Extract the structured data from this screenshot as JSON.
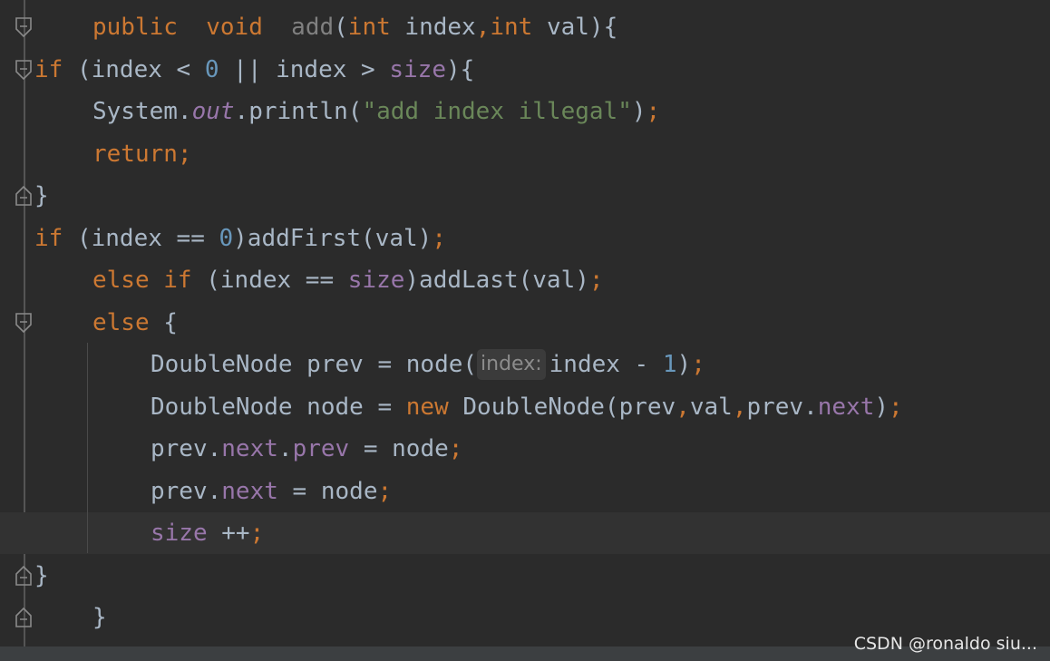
{
  "editor": {
    "colors": {
      "background": "#2b2b2b",
      "current_line": "#323232",
      "keyword": "#cc7832",
      "identifier": "#a9b7c6",
      "field": "#9876aa",
      "number": "#6897bb",
      "string": "#6a8759",
      "unused": "#808080"
    },
    "lines": [
      {
        "tokens": [
          {
            "t": "public",
            "c": "#cc7832"
          },
          {
            "t": "  ",
            "c": "#a9b7c6"
          },
          {
            "t": "void",
            "c": "#cc7832"
          },
          {
            "t": "  ",
            "c": "#a9b7c6"
          },
          {
            "t": "add",
            "c": "#808080"
          },
          {
            "t": "(",
            "c": "#a9b7c6"
          },
          {
            "t": "int",
            "c": "#cc7832"
          },
          {
            "t": " index",
            "c": "#a9b7c6"
          },
          {
            "t": ",",
            "c": "#cc7832"
          },
          {
            "t": "int",
            "c": "#cc7832"
          },
          {
            "t": " val){",
            "c": "#a9b7c6"
          }
        ]
      },
      {
        "tokens": [
          {
            "t": "if",
            "c": "#cc7832"
          },
          {
            "t": " (index < ",
            "c": "#a9b7c6"
          },
          {
            "t": "0",
            "c": "#6897bb"
          },
          {
            "t": " || index > ",
            "c": "#a9b7c6"
          },
          {
            "t": "size",
            "c": "#9876aa"
          },
          {
            "t": "){",
            "c": "#a9b7c6"
          }
        ]
      },
      {
        "tokens": [
          {
            "t": "System.",
            "c": "#a9b7c6"
          },
          {
            "t": "out",
            "c": "#9876aa",
            "i": true
          },
          {
            "t": ".println(",
            "c": "#a9b7c6"
          },
          {
            "t": "\"add index illegal\"",
            "c": "#6a8759"
          },
          {
            "t": ")",
            "c": "#a9b7c6"
          },
          {
            "t": ";",
            "c": "#cc7832"
          }
        ]
      },
      {
        "tokens": [
          {
            "t": "return;",
            "c": "#cc7832"
          }
        ]
      },
      {
        "tokens": [
          {
            "t": "}",
            "c": "#a9b7c6"
          }
        ]
      },
      {
        "tokens": [
          {
            "t": "if",
            "c": "#cc7832"
          },
          {
            "t": " (index == ",
            "c": "#a9b7c6"
          },
          {
            "t": "0",
            "c": "#6897bb"
          },
          {
            "t": ")addFirst(val)",
            "c": "#a9b7c6"
          },
          {
            "t": ";",
            "c": "#cc7832"
          }
        ]
      },
      {
        "tokens": [
          {
            "t": "else if",
            "c": "#cc7832"
          },
          {
            "t": " (index == ",
            "c": "#a9b7c6"
          },
          {
            "t": "size",
            "c": "#9876aa"
          },
          {
            "t": ")addLast(val)",
            "c": "#a9b7c6"
          },
          {
            "t": ";",
            "c": "#cc7832"
          }
        ]
      },
      {
        "tokens": [
          {
            "t": "else",
            "c": "#cc7832"
          },
          {
            "t": " {",
            "c": "#a9b7c6"
          }
        ]
      },
      {
        "tokens": [
          {
            "t": "DoubleNode prev = node(",
            "c": "#a9b7c6"
          },
          {
            "hint": "index:"
          },
          {
            "t": "index - ",
            "c": "#a9b7c6"
          },
          {
            "t": "1",
            "c": "#6897bb"
          },
          {
            "t": ")",
            "c": "#a9b7c6"
          },
          {
            "t": ";",
            "c": "#cc7832"
          }
        ]
      },
      {
        "tokens": [
          {
            "t": "DoubleNode node = ",
            "c": "#a9b7c6"
          },
          {
            "t": "new",
            "c": "#cc7832"
          },
          {
            "t": " DoubleNode(prev",
            "c": "#a9b7c6"
          },
          {
            "t": ",",
            "c": "#cc7832"
          },
          {
            "t": "val",
            "c": "#a9b7c6"
          },
          {
            "t": ",",
            "c": "#cc7832"
          },
          {
            "t": "prev.",
            "c": "#a9b7c6"
          },
          {
            "t": "next",
            "c": "#9876aa"
          },
          {
            "t": ")",
            "c": "#a9b7c6"
          },
          {
            "t": ";",
            "c": "#cc7832"
          }
        ]
      },
      {
        "tokens": [
          {
            "t": "prev.",
            "c": "#a9b7c6"
          },
          {
            "t": "next",
            "c": "#9876aa"
          },
          {
            "t": ".",
            "c": "#a9b7c6"
          },
          {
            "t": "prev",
            "c": "#9876aa"
          },
          {
            "t": " = node",
            "c": "#a9b7c6"
          },
          {
            "t": ";",
            "c": "#cc7832"
          }
        ]
      },
      {
        "tokens": [
          {
            "t": "prev.",
            "c": "#a9b7c6"
          },
          {
            "t": "next",
            "c": "#9876aa"
          },
          {
            "t": " = node",
            "c": "#a9b7c6"
          },
          {
            "t": ";",
            "c": "#cc7832"
          }
        ]
      },
      {
        "tokens": [
          {
            "t": "size",
            "c": "#9876aa"
          },
          {
            "t": " ++",
            "c": "#a9b7c6"
          },
          {
            "t": ";",
            "c": "#cc7832"
          }
        ]
      },
      {
        "tokens": [
          {
            "t": "}",
            "c": "#a9b7c6"
          }
        ]
      },
      {
        "tokens": [
          {
            "t": "}",
            "c": "#a9b7c6"
          }
        ]
      }
    ]
  },
  "watermark": "CSDN @ronaldo siu..."
}
